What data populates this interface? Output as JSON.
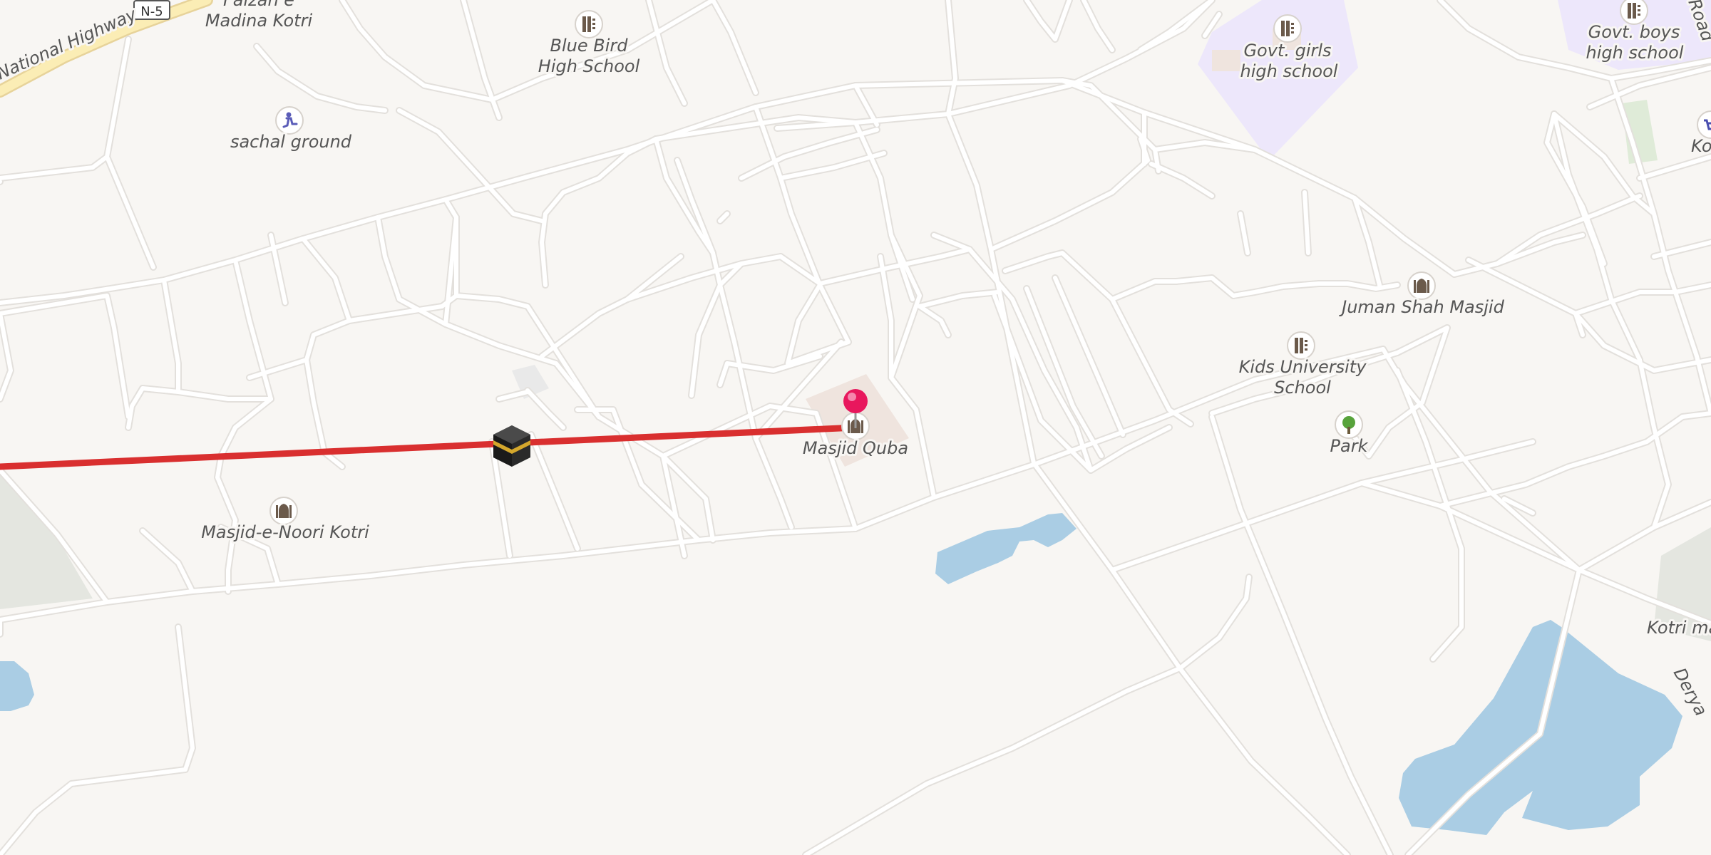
{
  "map": {
    "highway_badge": "N-5",
    "highway_name": "National Highway",
    "route_color": "#d92f2f",
    "destination_pin_color": "#e8175d",
    "colors": {
      "land": "#f8f6f3",
      "water": "#aacde4",
      "school_area": "#ede7fb",
      "park_area": "#dfebd8",
      "road": "#ffffff"
    }
  },
  "pois": [
    {
      "id": "faizan-e-madina",
      "line1": "Faizan e",
      "line2": "Madina Kotri",
      "icon": "none"
    },
    {
      "id": "blue-bird",
      "line1": "Blue Bird",
      "line2": "High School",
      "icon": "school-icon"
    },
    {
      "id": "sachal-ground",
      "line1": "sachal ground",
      "line2": "",
      "icon": "sports-ground-icon"
    },
    {
      "id": "govt-girls",
      "line1": "Govt. girls",
      "line2": "high school",
      "icon": "school-icon"
    },
    {
      "id": "govt-boys",
      "line1": "Govt. boys",
      "line2": "high school",
      "icon": "school-icon"
    },
    {
      "id": "kotri-ma",
      "line1": "Kotri Ma",
      "line2": "",
      "icon": "shop-icon"
    },
    {
      "id": "juman-shah",
      "line1": "Juman Shah Masjid",
      "line2": "",
      "icon": "mosque-icon"
    },
    {
      "id": "kids-university",
      "line1": "Kids University",
      "line2": "School",
      "icon": "school-icon"
    },
    {
      "id": "park",
      "line1": "Park",
      "line2": "",
      "icon": "tree-icon"
    },
    {
      "id": "masjid-quba",
      "line1": "Masjid Quba",
      "line2": "",
      "icon": "mosque-icon"
    },
    {
      "id": "masjid-e-noori",
      "line1": "Masjid-e-Noori Kotri",
      "line2": "",
      "icon": "mosque-icon"
    },
    {
      "id": "kotri-ma-2",
      "line1": "Kotri ma",
      "line2": "",
      "icon": "none"
    }
  ],
  "street_labels": {
    "road_top_right": "Road",
    "derya": "Derya"
  },
  "qibla_marker": "kaaba-icon"
}
